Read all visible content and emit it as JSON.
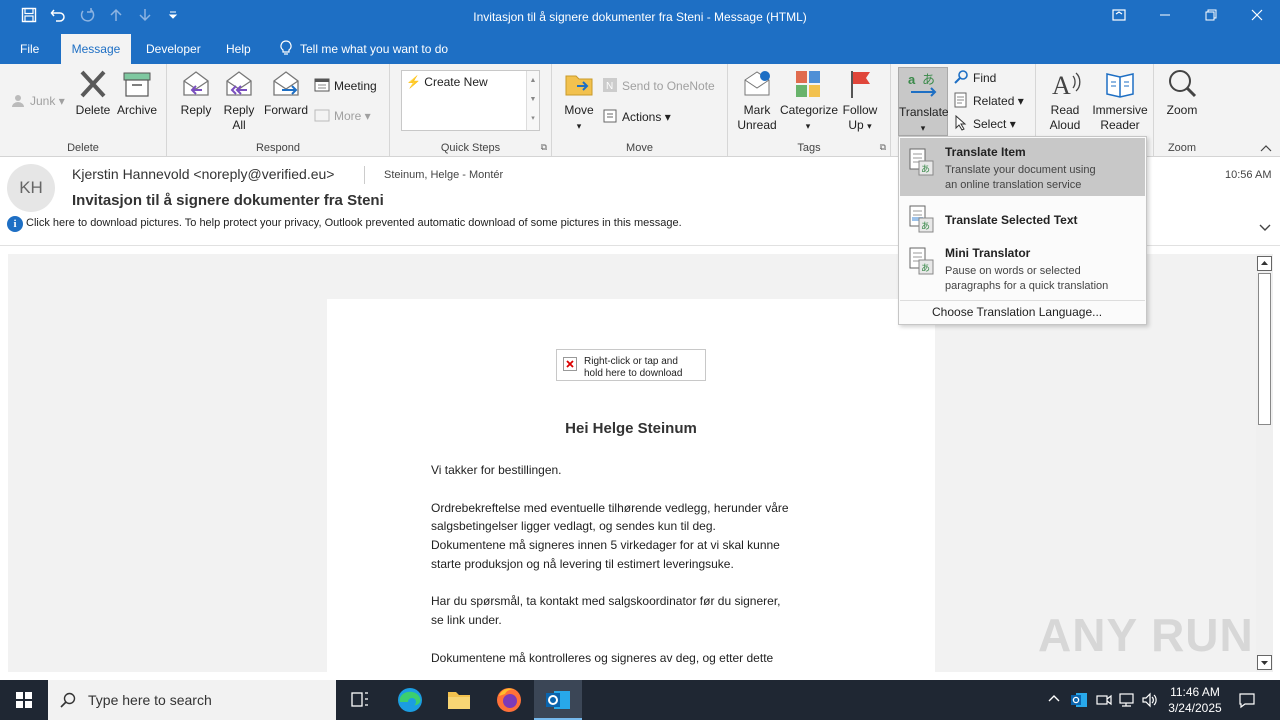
{
  "window": {
    "title": "Invitasjon til å signere dokumenter fra Steni  -  Message (HTML)"
  },
  "menu": {
    "tabs": [
      {
        "label": "File"
      },
      {
        "label": "Message"
      },
      {
        "label": "Developer"
      },
      {
        "label": "Help"
      }
    ],
    "tell_me": "Tell me what you want to do"
  },
  "ribbon": {
    "delete_group": {
      "label": "Delete",
      "junk": "Junk",
      "delete": "Delete",
      "archive": "Archive"
    },
    "respond_group": {
      "label": "Respond",
      "reply": "Reply",
      "reply_all_1": "Reply",
      "reply_all_2": "All",
      "forward": "Forward",
      "meeting": "Meeting",
      "more": "More"
    },
    "quicksteps_group": {
      "label": "Quick Steps",
      "create_new": "Create New"
    },
    "move_group": {
      "label": "Move",
      "move": "Move",
      "send_onenote": "Send to OneNote",
      "actions": "Actions"
    },
    "tags_group": {
      "label": "Tags",
      "mark_unread_1": "Mark",
      "mark_unread_2": "Unread",
      "categorize": "Categorize",
      "follow_up_1": "Follow",
      "follow_up_2": "Up"
    },
    "editing_group": {
      "translate": "Translate",
      "find": "Find",
      "related": "Related",
      "select": "Select"
    },
    "speech_group": {
      "read_aloud_1": "Read",
      "read_aloud_2": "Aloud",
      "immersive_1": "Immersive",
      "immersive_2": "Reader"
    },
    "zoom_group": {
      "label": "Zoom",
      "zoom": "Zoom"
    }
  },
  "message": {
    "avatar_initials": "KH",
    "sender": "Kjerstin Hannevold <noreply@verified.eu>",
    "recipient": "Steinum, Helge  - Montér",
    "subject": "Invitasjon til å signere dokumenter fra Steni",
    "time": "10:56 AM",
    "info_bar": "Click here to download pictures. To help protect your privacy, Outlook prevented automatic download of some pictures in this message."
  },
  "email_body": {
    "image_placeholder_1": "Right-click or tap and",
    "image_placeholder_2": "hold here to download",
    "greeting": "Hei Helge Steinum",
    "line1": "Vi takker for bestillingen.",
    "p2_1": "Ordrebekreftelse med eventuelle  tilhørende  vedlegg, herunder våre",
    "p2_2": "salgsbetingelser ligger vedlagt, og sendes kun til deg.",
    "p2_3": "Dokumentene  må signeres innen  5 virkedager for at vi skal kunne",
    "p2_4": "starte produksjon og nå levering til estimert leveringsuke.",
    "p3_1": "Har du spørsmål, ta kontakt med salgskoordinator før du signerer,",
    "p3_2": "se link  under.",
    "p4_1": "Dokumentene  må kontrolleres og signeres av deg, og etter  dette"
  },
  "translate_menu": {
    "item1_title": "Translate Item",
    "item1_desc1": "Translate your document using",
    "item1_desc2": "an online translation service",
    "item2_title": "Translate Selected Text",
    "item3_title": "Mini Translator",
    "item3_desc1": "Pause on words or selected",
    "item3_desc2": "paragraphs for a quick translation",
    "choose_language": "Choose Translation Language..."
  },
  "watermark": "ANY RUN",
  "taskbar": {
    "search_placeholder": "Type here to search",
    "time": "11:46 AM",
    "date": "3/24/2025"
  },
  "colors": {
    "accent": "#1e6fc4",
    "ribbon_bg": "#f3f3f3",
    "taskbar": "#1f2733",
    "menu_highlight": "#c8c8c8"
  }
}
